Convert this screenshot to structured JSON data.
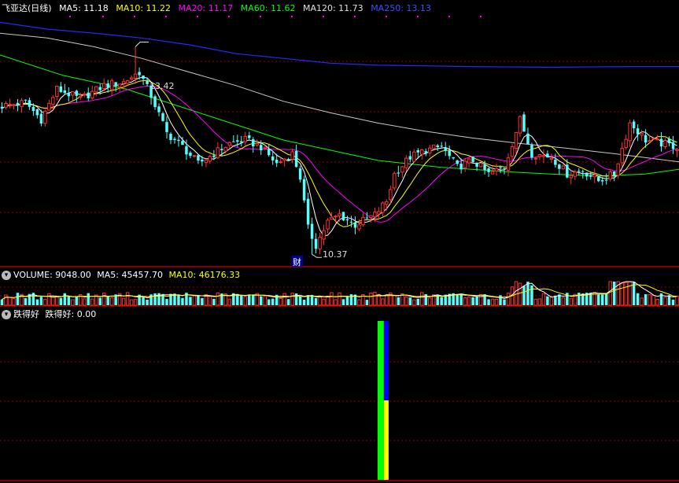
{
  "main_header": {
    "title": "飞亚达(日线)",
    "ma5": "MA5: 11.18",
    "ma10": "MA10: 11.22",
    "ma20": "MA20: 11.17",
    "ma60": "MA60: 11.62",
    "ma120": "MA120: 11.73",
    "ma250": "MA250: 13.13"
  },
  "volume_header": {
    "title": "VOLUME: 9048.00",
    "ma5": "MA5: 45457.70",
    "ma10": "MA10: 46176.33"
  },
  "indicator_header": {
    "name": "跌得好",
    "value": "跌得好: 0.00"
  },
  "annotations": {
    "high": "13.42",
    "low": "10.37",
    "finance_marker": "财"
  },
  "colors": {
    "background": "#000000",
    "grid": "#8b0000",
    "up": "#ff3232",
    "down": "#54ffff",
    "ma5": "#ffffff",
    "ma10": "#ffff00",
    "ma20": "#ff00ff",
    "ma60": "#00ff00",
    "ma120": "#c8c8c8",
    "ma250": "#2828ff",
    "ind_green": "#00ff00",
    "ind_blue": "#0000ff",
    "ind_yellow": "#ffff00"
  },
  "chart_data": {
    "type": "candlestick",
    "price_range": [
      10.2,
      13.9
    ],
    "moving_averages": {
      "ma120_path": [
        [
          0,
          13.62
        ],
        [
          60,
          13.55
        ],
        [
          120,
          13.42
        ],
        [
          180,
          13.25
        ],
        [
          240,
          13.05
        ],
        [
          300,
          12.85
        ],
        [
          360,
          12.62
        ],
        [
          420,
          12.45
        ],
        [
          480,
          12.3
        ],
        [
          540,
          12.18
        ],
        [
          600,
          12.08
        ],
        [
          660,
          12.0
        ],
        [
          720,
          11.93
        ],
        [
          780,
          11.85
        ],
        [
          863,
          11.73
        ]
      ],
      "ma250_path": [
        [
          0,
          13.78
        ],
        [
          60,
          13.68
        ],
        [
          120,
          13.62
        ],
        [
          180,
          13.55
        ],
        [
          240,
          13.45
        ],
        [
          300,
          13.32
        ],
        [
          360,
          13.25
        ],
        [
          420,
          13.18
        ],
        [
          480,
          13.15
        ],
        [
          540,
          13.14
        ],
        [
          600,
          13.13
        ],
        [
          700,
          13.12
        ],
        [
          800,
          13.13
        ],
        [
          863,
          13.13
        ]
      ],
      "ma60_path": [
        [
          0,
          13.3
        ],
        [
          40,
          13.15
        ],
        [
          80,
          13.0
        ],
        [
          120,
          12.9
        ],
        [
          160,
          12.8
        ],
        [
          200,
          12.65
        ],
        [
          240,
          12.5
        ],
        [
          280,
          12.35
        ],
        [
          320,
          12.2
        ],
        [
          360,
          12.05
        ],
        [
          400,
          11.95
        ],
        [
          440,
          11.85
        ],
        [
          480,
          11.75
        ],
        [
          520,
          11.7
        ],
        [
          560,
          11.65
        ],
        [
          600,
          11.62
        ],
        [
          650,
          11.58
        ],
        [
          700,
          11.55
        ],
        [
          760,
          11.52
        ],
        [
          820,
          11.55
        ],
        [
          863,
          11.62
        ]
      ]
    },
    "indicator": {
      "bar_index": 97,
      "green_range": [
        0,
        1
      ],
      "blue_range": [
        0.5,
        1
      ],
      "yellow_range": [
        0,
        0.5
      ]
    }
  }
}
